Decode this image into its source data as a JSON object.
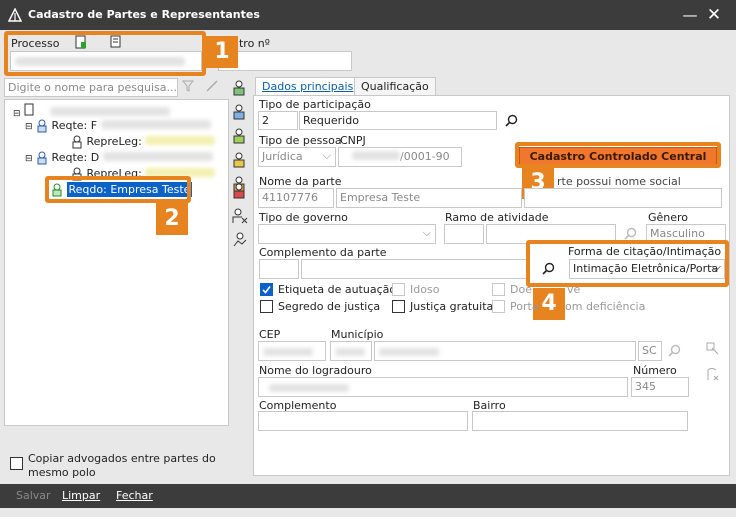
{
  "window": {
    "title": "Cadastro de Partes e Representantes"
  },
  "colors": {
    "accent_orange": "#e8841f",
    "selection_blue": "#0a62c8",
    "titlebar": "#3c3c3c"
  },
  "header": {
    "processo_label": "Processo",
    "outro_label": "utro nº"
  },
  "search": {
    "placeholder": "Digite o nome para pesquisa..."
  },
  "tree": {
    "items": [
      {
        "label": "Reqte: F"
      },
      {
        "label": "RepreLeg:"
      },
      {
        "label": "Reqte: D"
      },
      {
        "label": "RepreLeg:"
      },
      {
        "label": "Reqdo: Empresa Teste",
        "selected": true
      }
    ]
  },
  "copy_lawyers": {
    "label": "Copiar advogados entre partes do mesmo polo"
  },
  "tabs": [
    {
      "label": "Dados principais",
      "active": true
    },
    {
      "label": "Qualificação"
    }
  ],
  "form": {
    "tipo_participacao": {
      "label": "Tipo de participação",
      "code": "2",
      "value": "Requerido"
    },
    "tipo_pessoa": {
      "label": "Tipo de pessoa",
      "value": "Jurídica"
    },
    "cnpj": {
      "label": "CNPJ",
      "value": "/0001-90"
    },
    "cadastro_button": "Cadastro Controlado Central",
    "nome_parte": {
      "label": "Nome da parte",
      "code": "41107776",
      "value": "Empresa Teste"
    },
    "nome_social": {
      "label": "rte possui nome social"
    },
    "tipo_governo": {
      "label": "Tipo de governo"
    },
    "ramo_atividade": {
      "label": "Ramo de atividade"
    },
    "genero": {
      "label": "Gênero",
      "value": "Masculino"
    },
    "complemento_parte": {
      "label": "Complemento da parte"
    },
    "forma_citacao": {
      "label": "Forma de citação/Intimação",
      "value": "Intimação Eletrônica/Porta"
    },
    "checks": {
      "etiqueta": "Etiqueta de autuação",
      "idoso": "Idoso",
      "doente": "Doe",
      "doente_tail": "ve",
      "segredo": "Segredo de justiça",
      "justica": "Justiça gratuita",
      "porta": "Porta",
      "deficiencia": "om deficiência"
    },
    "cep": {
      "label": "CEP"
    },
    "municipio": {
      "label": "Município",
      "uf": "SC"
    },
    "logradouro": {
      "label": "Nome do logradouro"
    },
    "numero": {
      "label": "Número",
      "value": "345"
    },
    "complemento": {
      "label": "Complemento"
    },
    "bairro": {
      "label": "Bairro"
    }
  },
  "callouts": [
    "1",
    "2",
    "3",
    "4"
  ],
  "footer": {
    "salvar": "Salvar",
    "limpar": "Limpar",
    "fechar": "Fechar"
  }
}
